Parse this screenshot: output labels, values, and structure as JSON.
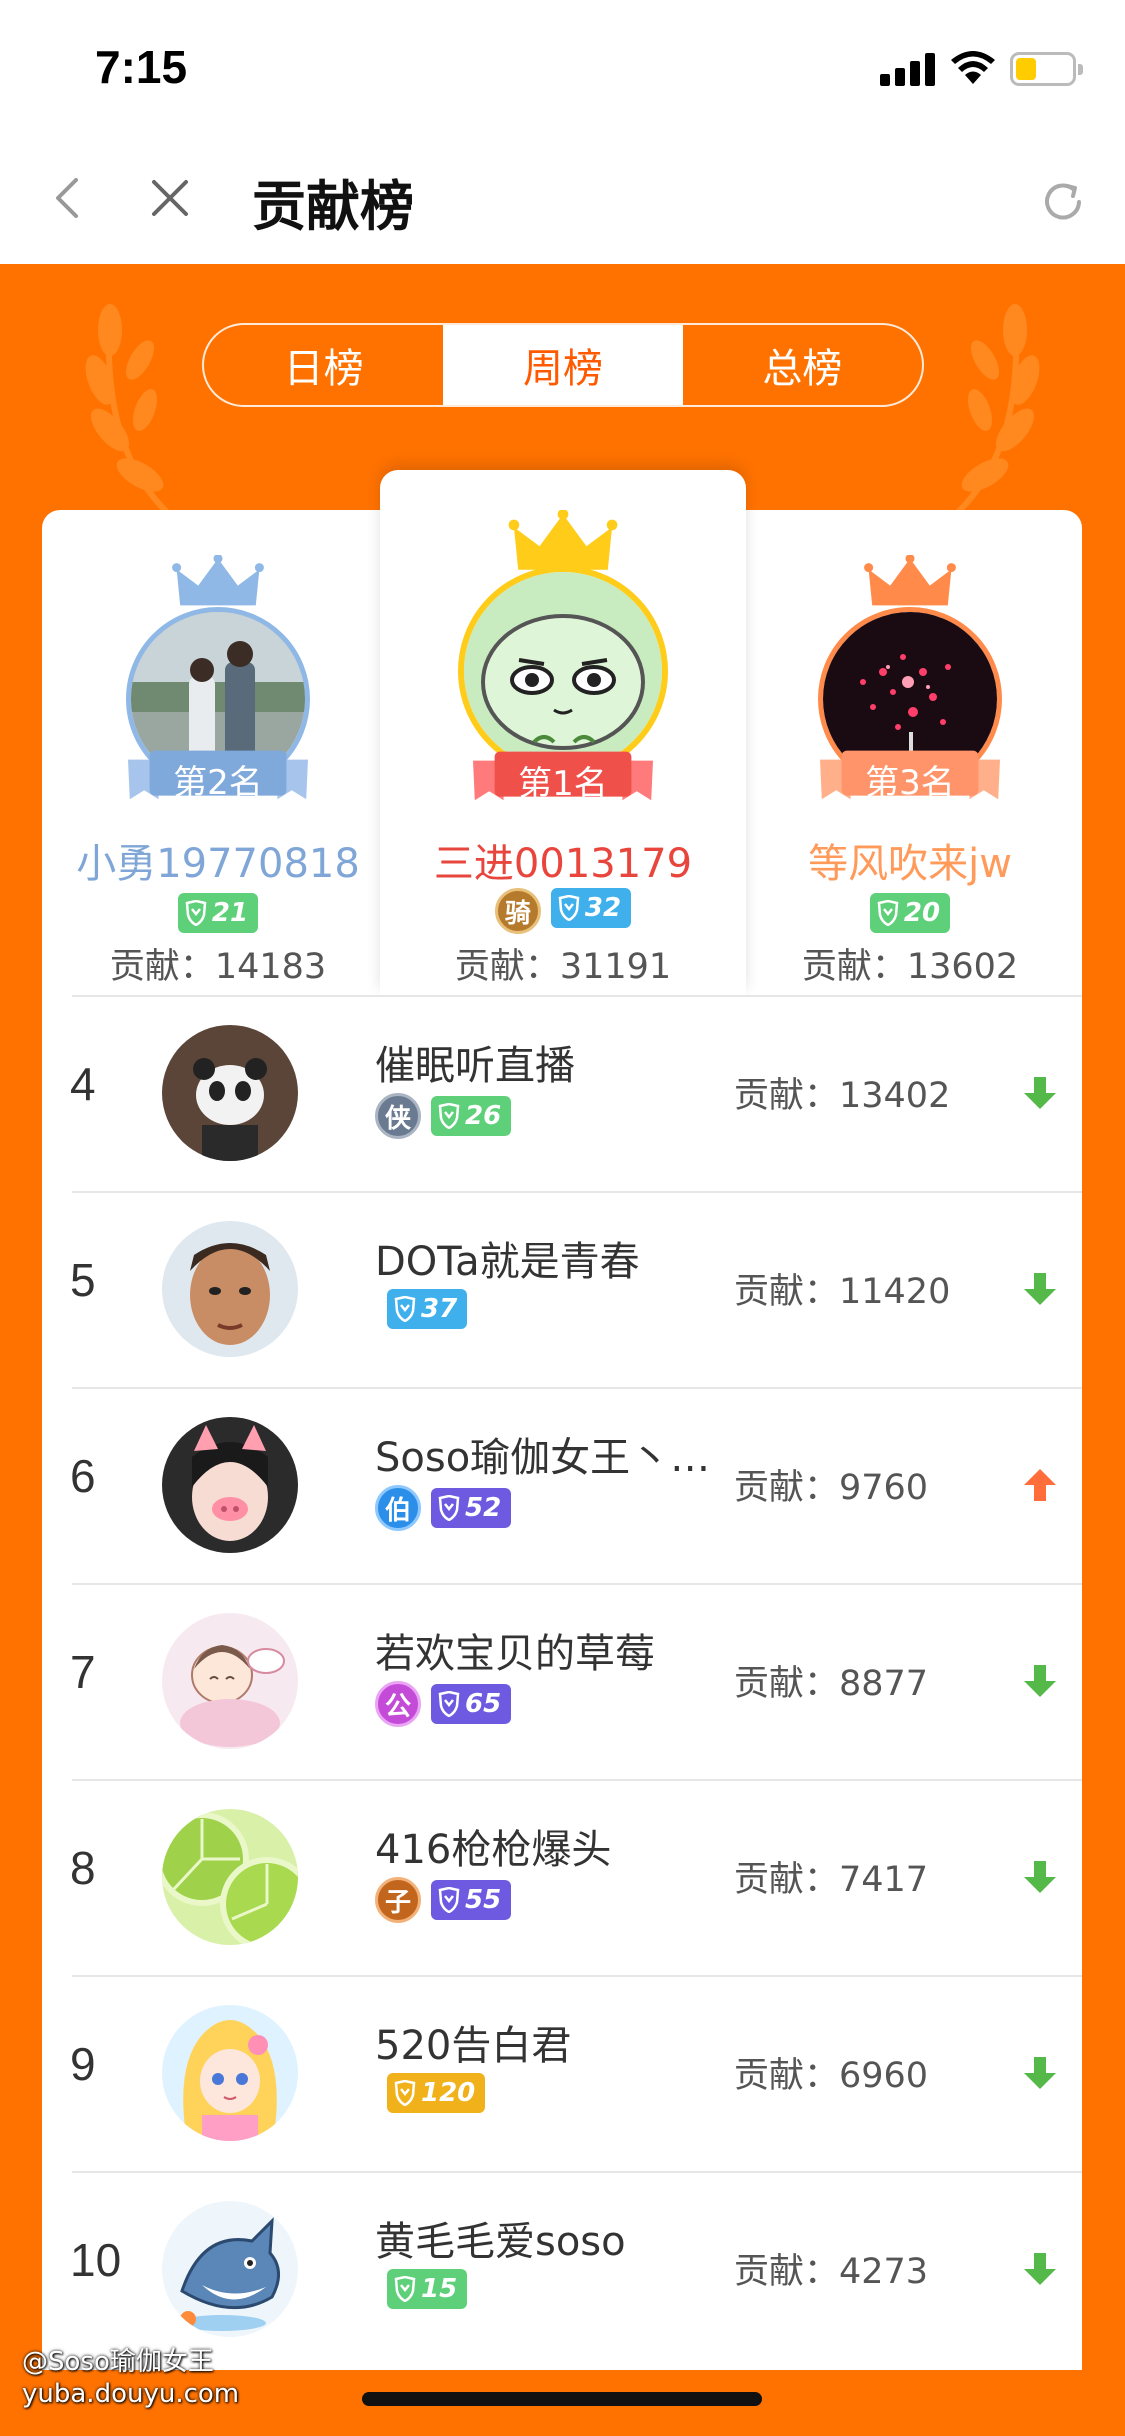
{
  "status_bar": {
    "time": "7:15"
  },
  "nav": {
    "title": "贡献榜"
  },
  "tabs": [
    {
      "label": "日榜",
      "active": false
    },
    {
      "label": "周榜",
      "active": true
    },
    {
      "label": "总榜",
      "active": false
    }
  ],
  "top3": [
    {
      "rank_label": "第2名",
      "name": "小勇19770818",
      "name_color": "#7fa6d6",
      "level": "21",
      "level_color": "#5fd07a",
      "contribution": "贡献：14183"
    },
    {
      "rank_label": "第1名",
      "name": "三进0013179",
      "name_color": "#e8453c",
      "medal": "骑",
      "level": "32",
      "level_color": "#3fb0ec",
      "contribution": "贡献：31191"
    },
    {
      "rank_label": "第3名",
      "name": "等风吹来jw",
      "name_color": "#ff9a5a",
      "level": "20",
      "level_color": "#5fd07a",
      "contribution": "贡献：13602"
    }
  ],
  "list": [
    {
      "rank": "4",
      "name": "催眠听直播",
      "medal": "侠",
      "medal_color": "#6a7a90",
      "level": "26",
      "level_color": "#5fd07a",
      "contribution": "贡献：13402",
      "trend": "down"
    },
    {
      "rank": "5",
      "name": "DOTa就是青春",
      "medal": "",
      "level": "37",
      "level_color": "#3fb0ec",
      "contribution": "贡献：11420",
      "trend": "down"
    },
    {
      "rank": "6",
      "name": "Soso瑜伽女王丶…",
      "medal": "伯",
      "medal_color": "#2b8ee8",
      "level": "52",
      "level_color": "#6e5ae0",
      "contribution": "贡献：9760",
      "trend": "up"
    },
    {
      "rank": "7",
      "name": "若欢宝贝的草莓",
      "medal": "公",
      "medal_color": "#c44bd8",
      "level": "65",
      "level_color": "#6e5ae0",
      "contribution": "贡献：8877",
      "trend": "down"
    },
    {
      "rank": "8",
      "name": "416枪枪爆头",
      "medal": "子",
      "medal_color": "#c2661e",
      "level": "55",
      "level_color": "#6e5ae0",
      "contribution": "贡献：7417",
      "trend": "down"
    },
    {
      "rank": "9",
      "name": "520告白君",
      "medal": "",
      "level": "120",
      "level_color": "#f0b11a",
      "contribution": "贡献：6960",
      "trend": "down"
    },
    {
      "rank": "10",
      "name": "黄毛毛爱soso",
      "medal": "",
      "level": "15",
      "level_color": "#5fd07a",
      "contribution": "贡献：4273",
      "trend": "down"
    }
  ],
  "watermark": {
    "line1": "@Soso瑜伽女王",
    "line2": "yuba.douyu.com"
  },
  "colors": {
    "brand_orange": "#ff7200",
    "trend_down": "#55b94a",
    "trend_up": "#ff6d3a"
  }
}
